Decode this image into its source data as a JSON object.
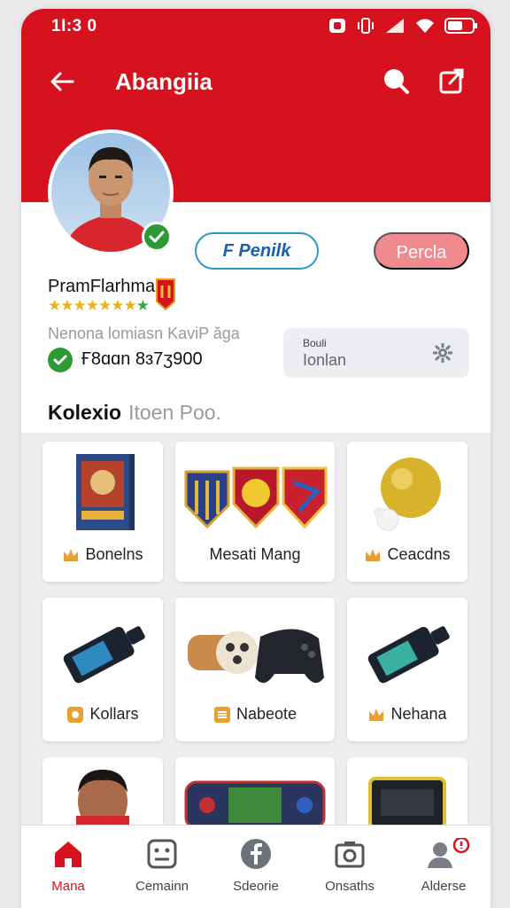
{
  "status": {
    "time": "1Ɩ:3 0"
  },
  "appbar": {
    "title": "Abangiia"
  },
  "profile": {
    "name": "PramFlarhma",
    "rating": "★★★★★★★",
    "rating_extra": "★",
    "subtitle": "Nenona lomiasn KaviP ăga",
    "phone": "Ғ8ɑɑn 8ɜ7ʒ900",
    "follow_label": "F Penilk",
    "primary_label": "Percla"
  },
  "search": {
    "label": "Bouli",
    "value": "Ionlan"
  },
  "section": {
    "title_bold": "Kolexio",
    "title_light": "Itoen Poo."
  },
  "cards": [
    {
      "label": "Bonelns",
      "icon": "crown-icon"
    },
    {
      "label": "Mesati Mang",
      "icon": ""
    },
    {
      "label": "Ceacdns",
      "icon": "crown-icon"
    },
    {
      "label": "Kollars",
      "icon": "coin-icon"
    },
    {
      "label": "Nabeote",
      "icon": "list-icon"
    },
    {
      "label": "Nehana",
      "icon": "crown-icon"
    }
  ],
  "nav": [
    {
      "label": "Mana",
      "icon": "home-icon"
    },
    {
      "label": "Cemainn",
      "icon": "gamepad-icon"
    },
    {
      "label": "Sdeorie",
      "icon": "facebook-icon"
    },
    {
      "label": "Onsaths",
      "icon": "camera-icon"
    },
    {
      "label": "Alderse",
      "icon": "profile-icon"
    }
  ],
  "colors": {
    "brand": "#d5121d",
    "accent": "#2c9ac8",
    "verified": "#2e9a36"
  }
}
